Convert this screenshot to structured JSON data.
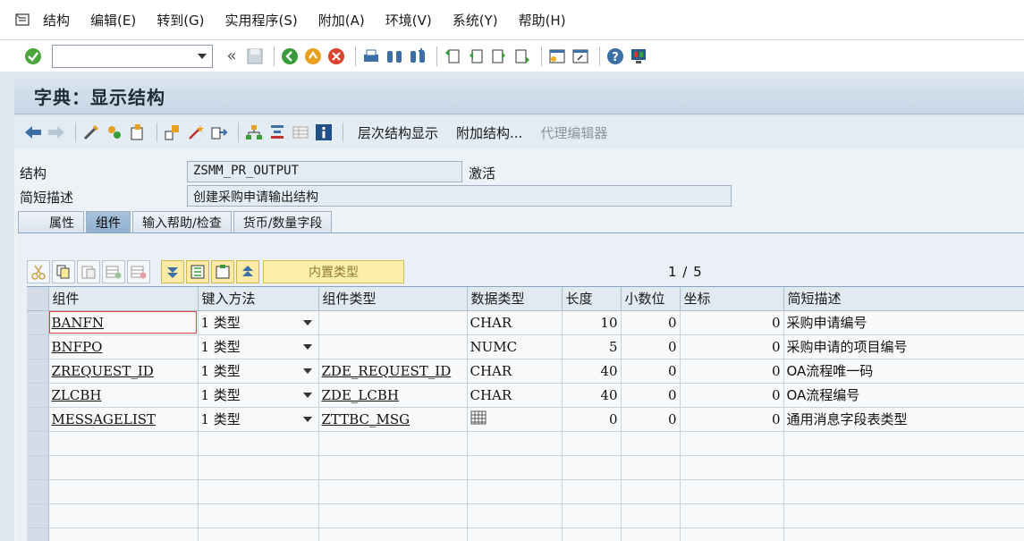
{
  "menu": {
    "items": [
      "结构",
      "编辑(E)",
      "转到(G)",
      "实用程序(S)",
      "附加(A)",
      "环境(V)",
      "系统(Y)",
      "帮助(H)"
    ]
  },
  "toolbar": {
    "command_value": "",
    "back_symbol": "«"
  },
  "title": "字典：显示结构",
  "app_toolbar": {
    "hierarchy_label": "层次结构显示",
    "append_label": "附加结构...",
    "proxy_label": "代理编辑器"
  },
  "header": {
    "structure_label": "结构",
    "structure_value": "ZSMM_PR_OUTPUT",
    "status_value": "激活",
    "desc_label": "简短描述",
    "desc_value": "创建采购申请输出结构"
  },
  "tabs": [
    "属性",
    "组件",
    "输入帮助/检查",
    "货币/数量字段"
  ],
  "active_tab": "组件",
  "grid_toolbar": {
    "builtin_type_label": "内置类型",
    "pager": "1 / 5"
  },
  "grid": {
    "columns": [
      "组件",
      "键入方法",
      "组件类型",
      "数据类型",
      "长度",
      "小数位",
      "坐标",
      "简短描述"
    ],
    "rows": [
      {
        "component": "BANFN",
        "typing": "1 类型",
        "comp_type": "",
        "data_type": "CHAR",
        "length": "10",
        "decimals": "0",
        "coord": "0",
        "desc": "采购申请编号"
      },
      {
        "component": "BNFPO",
        "typing": "1 类型",
        "comp_type": "",
        "data_type": "NUMC",
        "length": "5",
        "decimals": "0",
        "coord": "0",
        "desc": "采购申请的项目编号"
      },
      {
        "component": "ZREQUEST_ID",
        "typing": "1 类型",
        "comp_type": "ZDE_REQUEST_ID",
        "data_type": "CHAR",
        "length": "40",
        "decimals": "0",
        "coord": "0",
        "desc": "OA流程唯一码"
      },
      {
        "component": "ZLCBH",
        "typing": "1 类型",
        "comp_type": "ZDE_LCBH",
        "data_type": "CHAR",
        "length": "40",
        "decimals": "0",
        "coord": "0",
        "desc": "OA流程编号"
      },
      {
        "component": "MESSAGELIST",
        "typing": "1 类型",
        "comp_type": "ZTTBC_MSG",
        "data_type": "table-icon",
        "length": "0",
        "decimals": "0",
        "coord": "0",
        "desc": "通用消息字段表类型"
      }
    ]
  },
  "colors": {
    "title_bg": "#c7d6e5",
    "active_tab": "#8fb0d1",
    "builtin_btn": "#fcefa8"
  }
}
